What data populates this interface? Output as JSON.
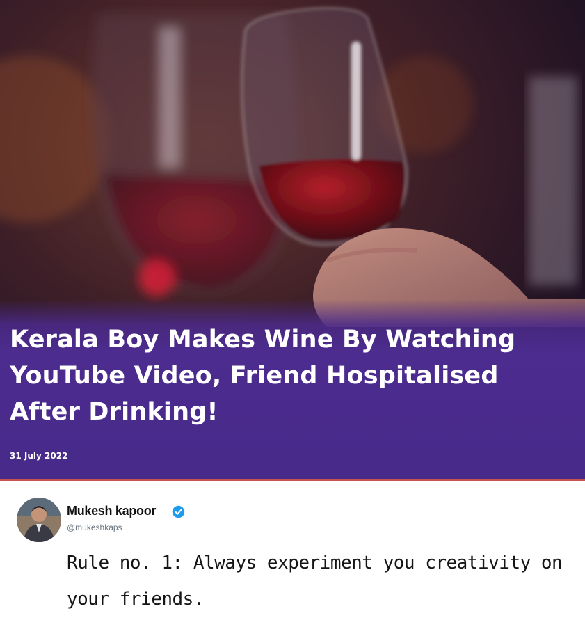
{
  "article": {
    "headline": "Kerala Boy Makes Wine By Watching YouTube Video, Friend Hospitalised After Drinking!",
    "date": "31 July 2022",
    "accent_color": "#4c2c8f"
  },
  "tweet": {
    "author_name": "Mukesh kapoor",
    "author_handle": "@mukeshkaps",
    "verified": true,
    "text": "Rule no. 1: Always experiment you creativity on your friends."
  }
}
